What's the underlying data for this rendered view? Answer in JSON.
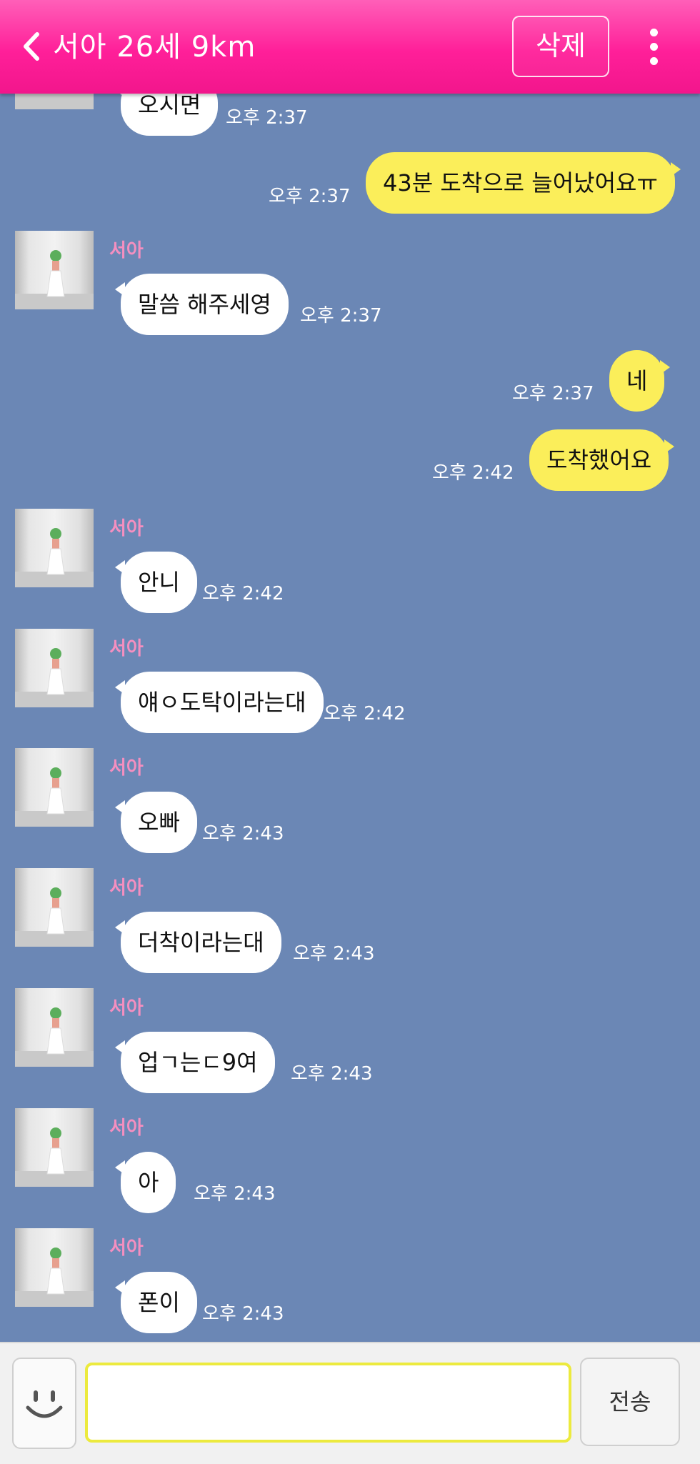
{
  "header": {
    "title": "서아 26세 9km",
    "delete_label": "삭제",
    "colors": {
      "bar": "#ff1f99",
      "text": "#ffffff"
    }
  },
  "chat": {
    "background_color": "#6b87b5",
    "messages": [
      {
        "sender": "",
        "text": "오시면",
        "time": "오후 2:37",
        "direction": "in"
      },
      {
        "sender": "",
        "text": "43분 도착으로 늘어났어요ㅠ",
        "time": "오후 2:37",
        "direction": "out"
      },
      {
        "sender": "서아",
        "text": "말씀 해주세영",
        "time": "오후 2:37",
        "direction": "in"
      },
      {
        "sender": "",
        "text": "네",
        "time": "오후 2:37",
        "direction": "out"
      },
      {
        "sender": "",
        "text": "도착했어요",
        "time": "오후 2:42",
        "direction": "out"
      },
      {
        "sender": "서아",
        "text": "안니",
        "time": "오후 2:42",
        "direction": "in"
      },
      {
        "sender": "서아",
        "text": "얘ㅇ도탁이라는대",
        "time": "오후 2:42",
        "direction": "in"
      },
      {
        "sender": "서아",
        "text": "오빠",
        "time": "오후 2:43",
        "direction": "in"
      },
      {
        "sender": "서아",
        "text": "더착이라는대",
        "time": "오후 2:43",
        "direction": "in"
      },
      {
        "sender": "서아",
        "text": "업ㄱ는ㄷ9여",
        "time": "오후 2:43",
        "direction": "in"
      },
      {
        "sender": "서아",
        "text": "아",
        "time": "오후 2:43",
        "direction": "in"
      },
      {
        "sender": "서아",
        "text": "폰이",
        "time": "오후 2:43",
        "direction": "in"
      }
    ]
  },
  "input_bar": {
    "message_value": "",
    "send_label": "전송"
  },
  "icons": [
    "chevron-left-icon",
    "more-vertical-icon",
    "smiley-icon"
  ]
}
